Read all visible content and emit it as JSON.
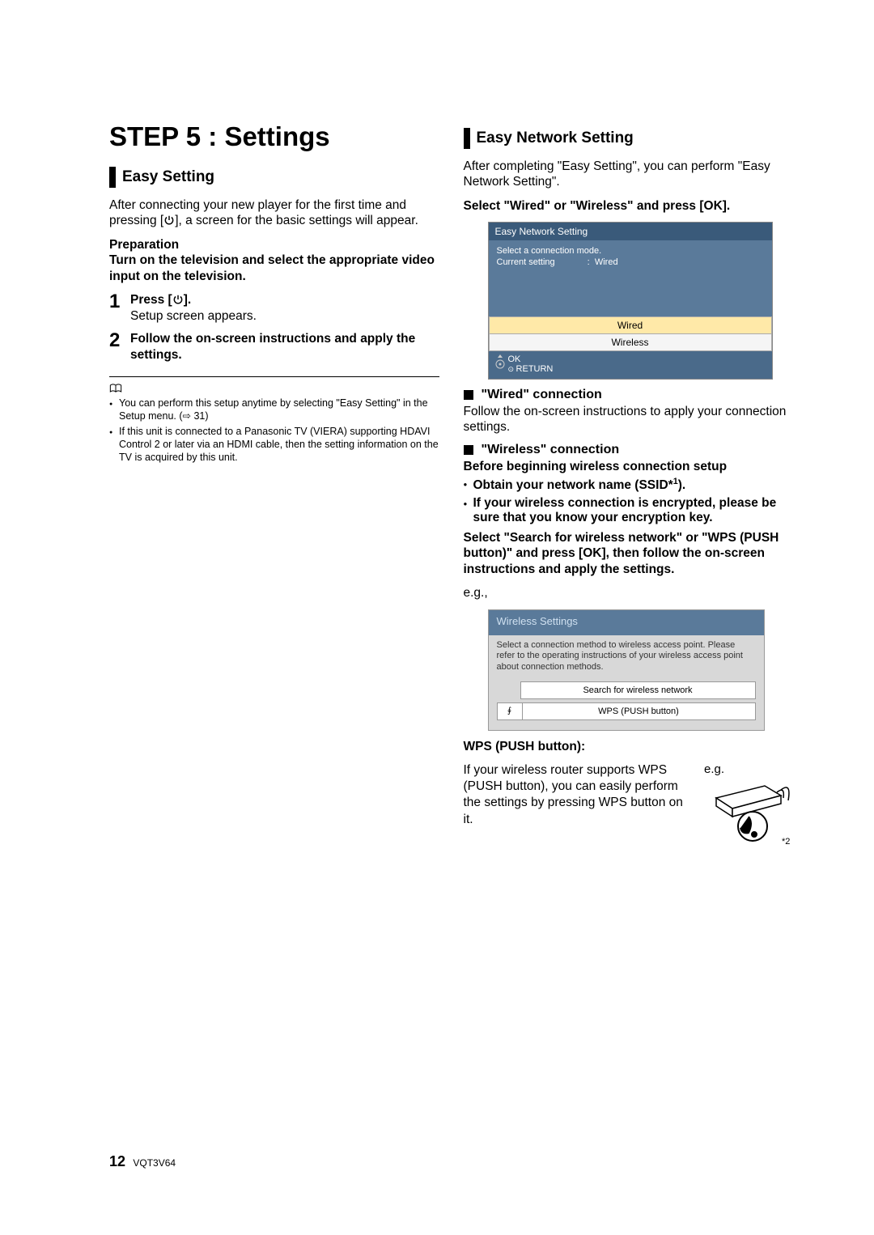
{
  "page": {
    "title": "STEP 5 :  Settings",
    "page_number": "12",
    "doc_id": "VQT3V64"
  },
  "left": {
    "section_title": "Easy Setting",
    "intro_a": "After connecting your new player for the first time and pressing [",
    "intro_b": "], a screen for the basic settings will appear.",
    "prep_label": "Preparation",
    "prep_text": "Turn on the television and select the appropriate video input on the television.",
    "step1_lead_a": "Press [",
    "step1_lead_b": "].",
    "step1_body": "Setup screen appears.",
    "step2_lead": "Follow the on-screen instructions and apply the settings.",
    "note1_a": "You can perform this setup anytime by selecting \"Easy Setting\" in the Setup menu. (",
    "note1_ref": "⇨ 31)",
    "note2": "If this unit is connected to a Panasonic TV (VIERA) supporting HDAVI Control 2 or later via an HDMI cable, then the setting information on the TV is acquired by this unit."
  },
  "right": {
    "section_title": "Easy Network Setting",
    "intro": "After completing \"Easy Setting\", you can perform \"Easy Network Setting\".",
    "select_line": "Select \"Wired\" or \"Wireless\" and press [OK].",
    "ens": {
      "title": "Easy Network Setting",
      "body1": "Select a connection mode.",
      "body2_label": "Current setting",
      "body2_value": "Wired",
      "opt_wired": "Wired",
      "opt_wireless": "Wireless",
      "ok": "OK",
      "return": "RETURN"
    },
    "wired_title": "\"Wired\" connection",
    "wired_text": "Follow the on-screen instructions to apply your connection settings.",
    "wireless_title": "\"Wireless\" connection",
    "wireless_before": "Before beginning wireless connection setup",
    "wireless_b1_a": "Obtain your network name (SSID*",
    "wireless_b1_b": ").",
    "wireless_b2": "If your wireless connection is encrypted, please be sure that you know your encryption key.",
    "wireless_select": "Select \"Search for wireless network\" or \"WPS (PUSH button)\" and press [OK], then follow the on-screen instructions and apply the settings.",
    "eg": "e.g.,",
    "ws": {
      "title": "Wireless Settings",
      "text": "Select a connection method to wireless access point. Please refer to the operating instructions of your wireless access point about connection methods.",
      "opt1": "Search for wireless network",
      "opt2": "WPS (PUSH button)"
    },
    "wps_label": "WPS (PUSH button):",
    "wps_text": "If your wireless router supports WPS (PUSH button), you can easily perform the settings by pressing WPS button on it.",
    "wps_eg": "e.g.",
    "wps_star": "*2"
  }
}
